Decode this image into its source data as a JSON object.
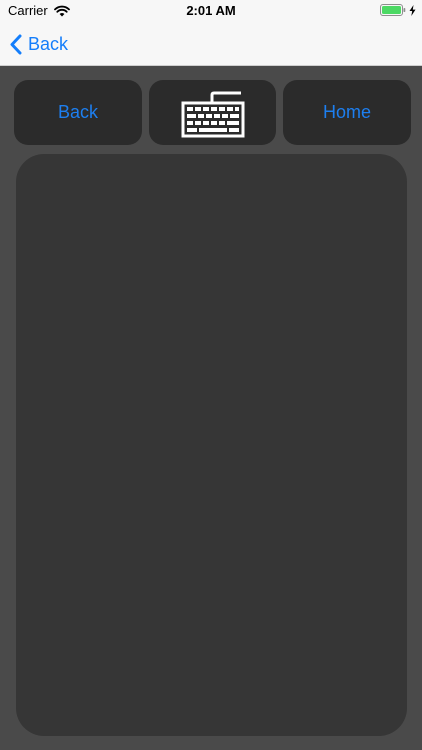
{
  "status_bar": {
    "carrier": "Carrier",
    "time": "2:01 AM",
    "battery_color": "#4cd964"
  },
  "nav_bar": {
    "back_label": "Back",
    "accent_color": "#147efb"
  },
  "controls": {
    "back_button_label": "Back",
    "keyboard_button_icon": "keyboard-icon",
    "home_button_label": "Home"
  },
  "trackpad": {
    "icon": "none"
  },
  "colors": {
    "background": "#4a4a4a",
    "tile": "#2b2b2b",
    "trackpad": "#363636",
    "button_text": "#1d7ff0"
  }
}
